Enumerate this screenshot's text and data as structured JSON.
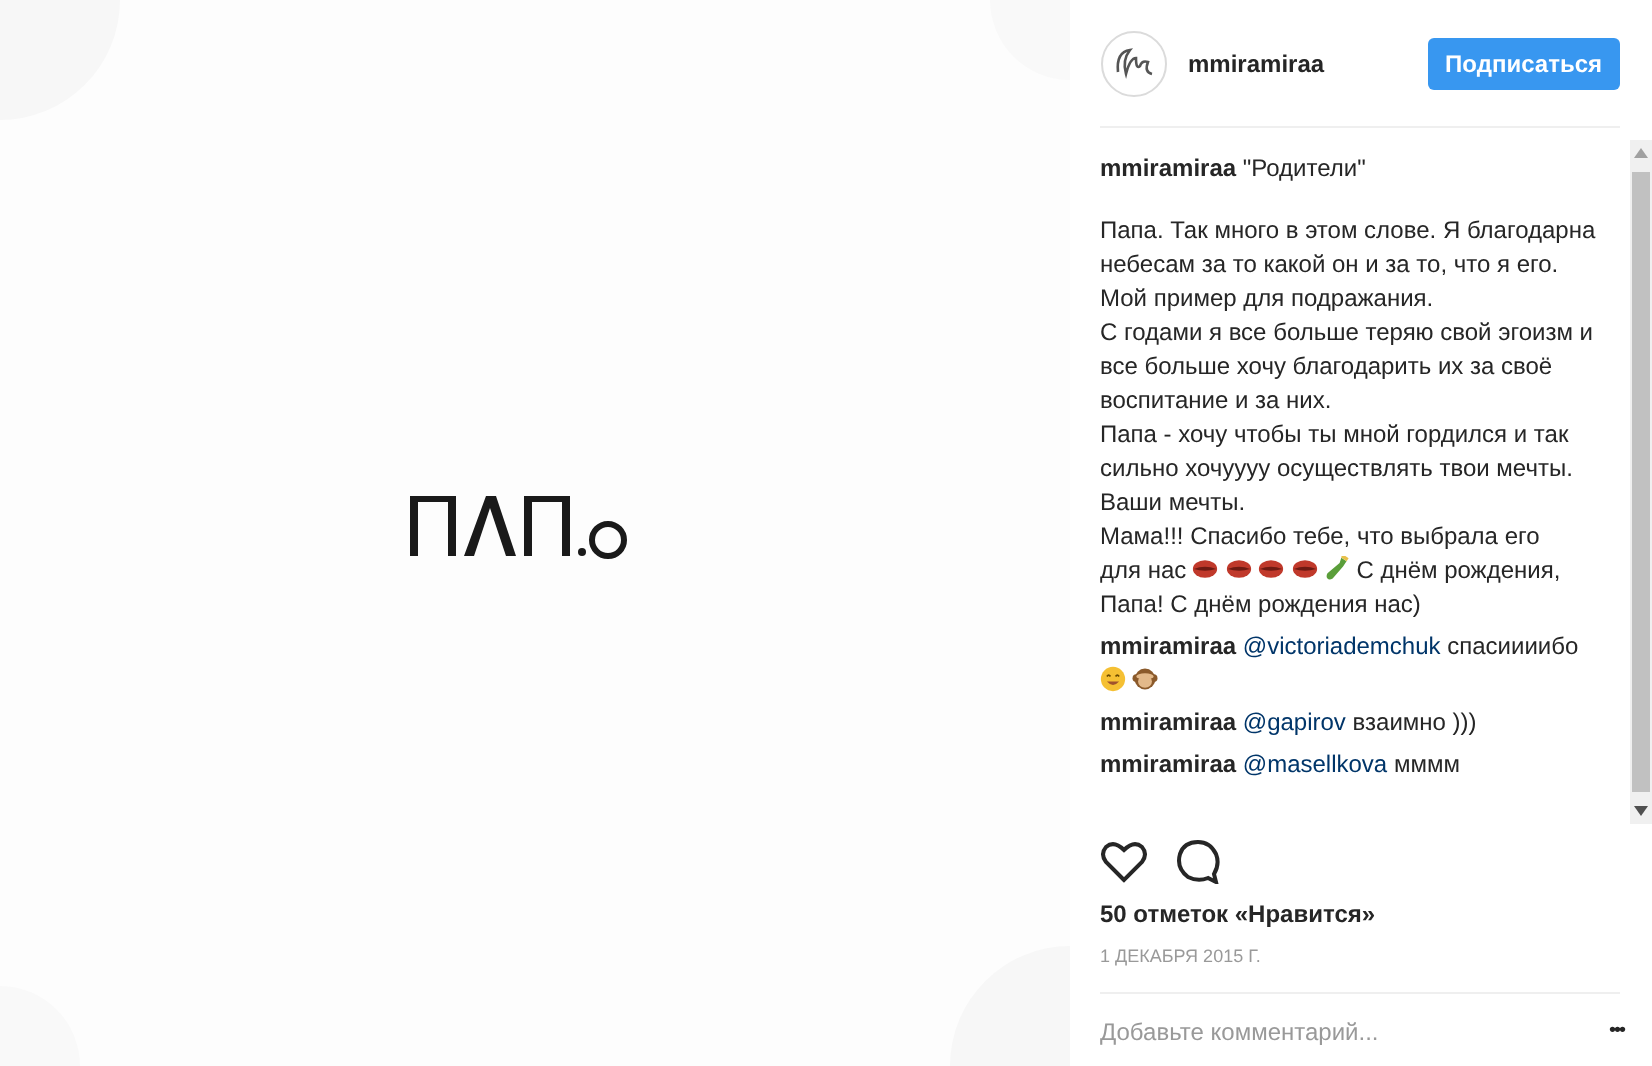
{
  "header": {
    "username": "mmiramiraa",
    "follow_button": "Подписаться"
  },
  "caption": {
    "username": "mmiramiraa",
    "title": "\"Родители\"",
    "paragraphs": [
      {
        "text": "Папа. Так много в этом слове. Я благодарна небесам за то какой он и за то, что я его. Мой пример для подражания."
      },
      {
        "text": "С годами я все больше теряю свой эгоизм и все больше хочу благодарить их за своё воспитание и за них."
      },
      {
        "text": "Папа - хочу чтобы ты мной гордился и так сильно хочуууу осуществлять твои мечты."
      },
      {
        "text": "Ваши мечты."
      },
      {
        "parts": [
          {
            "kind": "text",
            "text": "Мама!!! Спасибо тебе, что выбрала его"
          },
          {
            "kind": "text",
            "text": "для нас"
          },
          {
            "kind": "lips"
          },
          {
            "kind": "lips"
          },
          {
            "kind": "lips"
          },
          {
            "kind": "lips"
          },
          {
            "kind": "bottle"
          },
          {
            "kind": "text",
            "text": "С днём рождения,"
          },
          {
            "kind": "text",
            "text": "Папа! С днём рождения нас)"
          }
        ]
      }
    ]
  },
  "comments": [
    {
      "username": "mmiramiraa",
      "mention": "@victoriademchuk",
      "text": "спасиииибо",
      "emoji": [
        {
          "kind": "smiley"
        },
        {
          "kind": "monkey"
        }
      ]
    },
    {
      "username": "mmiramiraa",
      "mention": "@gapirov",
      "text": "взаимно )))"
    },
    {
      "username": "mmiramiraa",
      "mention": "@masellkova",
      "text": "мммм"
    }
  ],
  "likes": "50 отметок «Нравится»",
  "date": "1 ДЕКАБРЯ 2015 Г.",
  "comment_field": {
    "placeholder": "Добавьте комментарий..."
  },
  "more_button": "•••"
}
